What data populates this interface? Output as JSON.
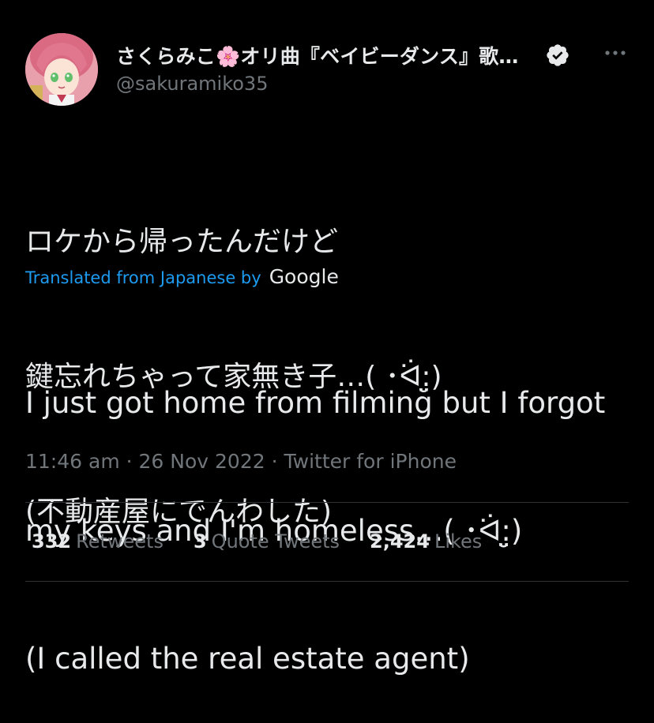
{
  "author": {
    "display_name": "さくらみこ🌸オリ曲『ベイビーダンス』歌…",
    "handle": "@sakuramiko35",
    "verified": true
  },
  "tweet": {
    "text_lines": [
      "ロケから帰ったんだけど",
      "鍵忘れちゃって家無き子…( ･ᐛ:̤̮)",
      "(不動産屋にでんわした)"
    ],
    "translated_label": "Translated from Japanese by",
    "translator": "Google",
    "translation_lines": [
      "I just got home from filming but I forgot",
      "my keys and I'm homeless…( ･ᐛ:̤̮)",
      "(I called the real estate agent)"
    ],
    "time": "11:46 am",
    "date": "26 Nov 2022",
    "source": "Twitter for iPhone"
  },
  "stats": [
    {
      "count": "332",
      "label": "Retweets"
    },
    {
      "count": "3",
      "label": "Quote Tweets"
    },
    {
      "count": "2,424",
      "label": "Likes"
    }
  ],
  "icons": {
    "verified": "verified-badge-icon",
    "more": "more-options-icon"
  }
}
